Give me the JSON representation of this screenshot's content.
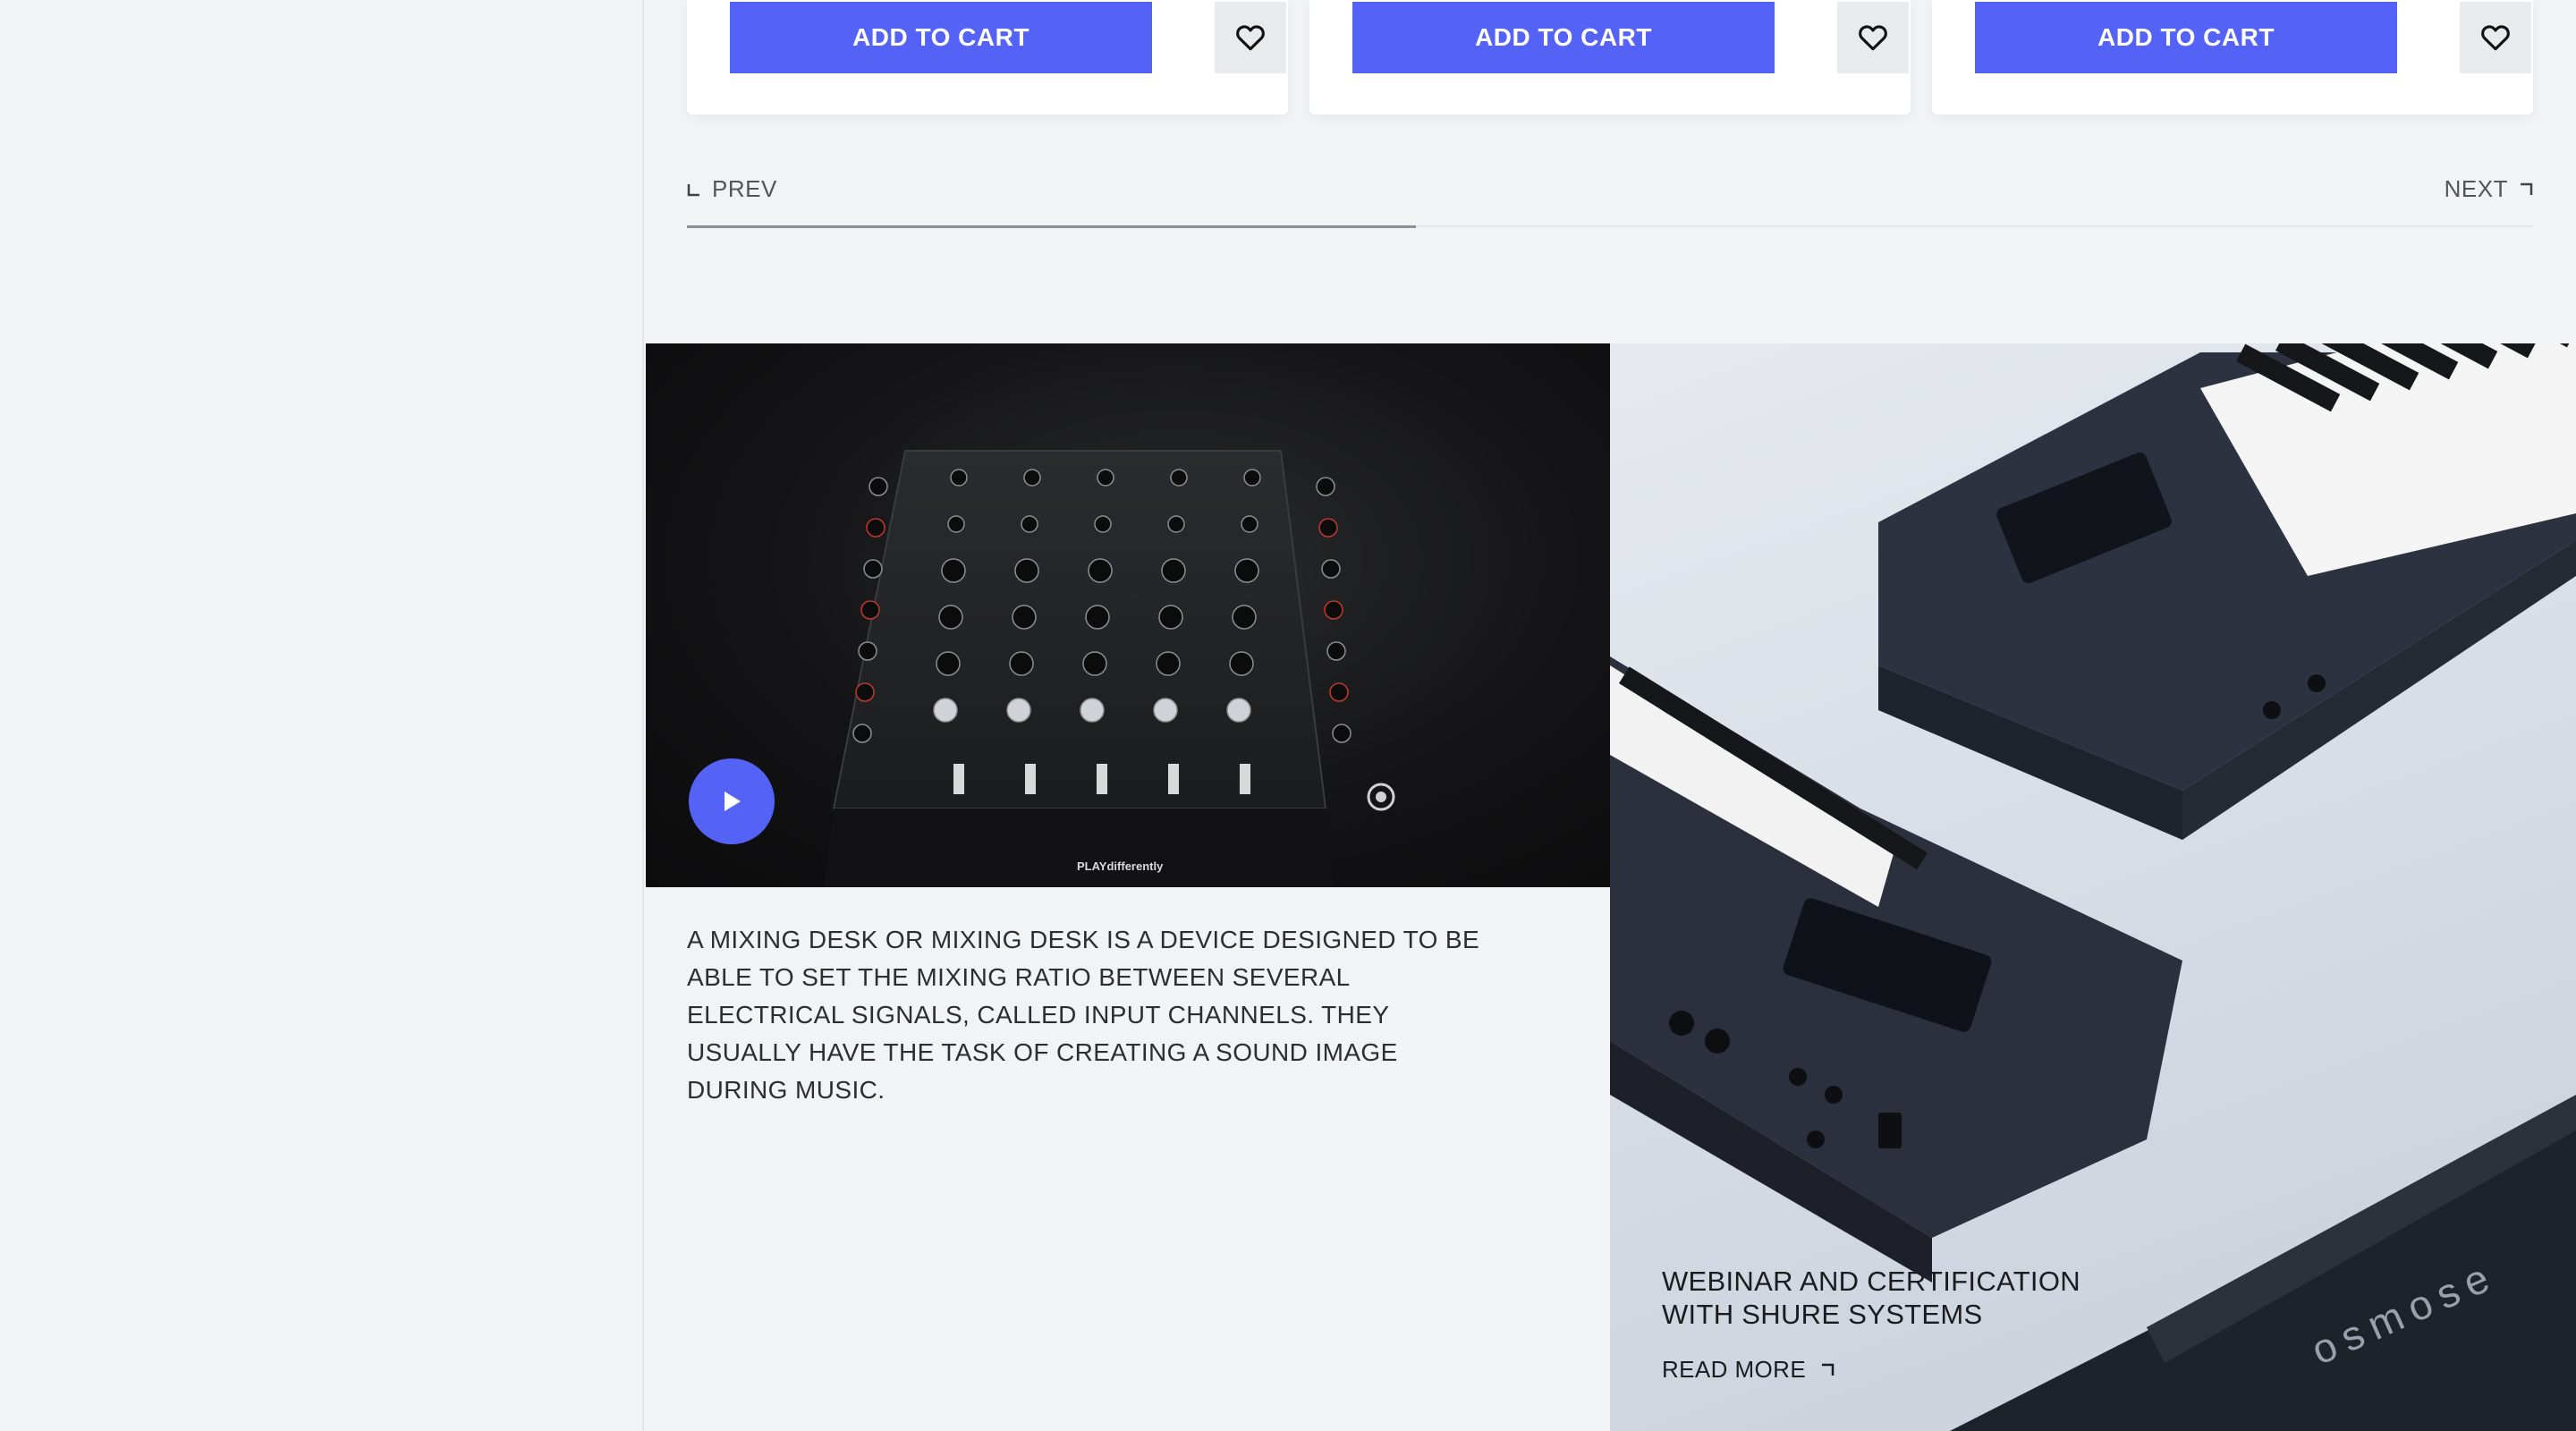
{
  "products": [
    {
      "cart_label": "ADD TO CART",
      "wishlist_icon": "heart-icon"
    },
    {
      "cart_label": "ADD TO CART",
      "wishlist_icon": "heart-icon"
    },
    {
      "cart_label": "ADD TO CART",
      "wishlist_icon": "heart-icon"
    }
  ],
  "pagination": {
    "prev_label": "PREV",
    "next_label": "NEXT",
    "progress_fraction": 0.395
  },
  "video": {
    "product_brand_text": "PLAYdifferently",
    "play_icon": "play-icon",
    "description": "A MIXING DESK OR MIXING DESK IS A DEVICE DESIGNED TO BE ABLE TO SET THE MIXING RATIO BETWEEN SEVERAL ELECTRICAL SIGNALS, CALLED INPUT CHANNELS. THEY USUALLY HAVE THE TASK OF CREATING A SOUND IMAGE DURING MUSIC."
  },
  "promo": {
    "title": "WEBINAR AND CERTIFICATION WITH SHURE SYSTEMS",
    "read_more": "READ MORE",
    "keyboard_brand_text": "osmose"
  },
  "colors": {
    "accent": "#5562f6",
    "background": "#f2f3f5",
    "text": "#2d2e31"
  }
}
